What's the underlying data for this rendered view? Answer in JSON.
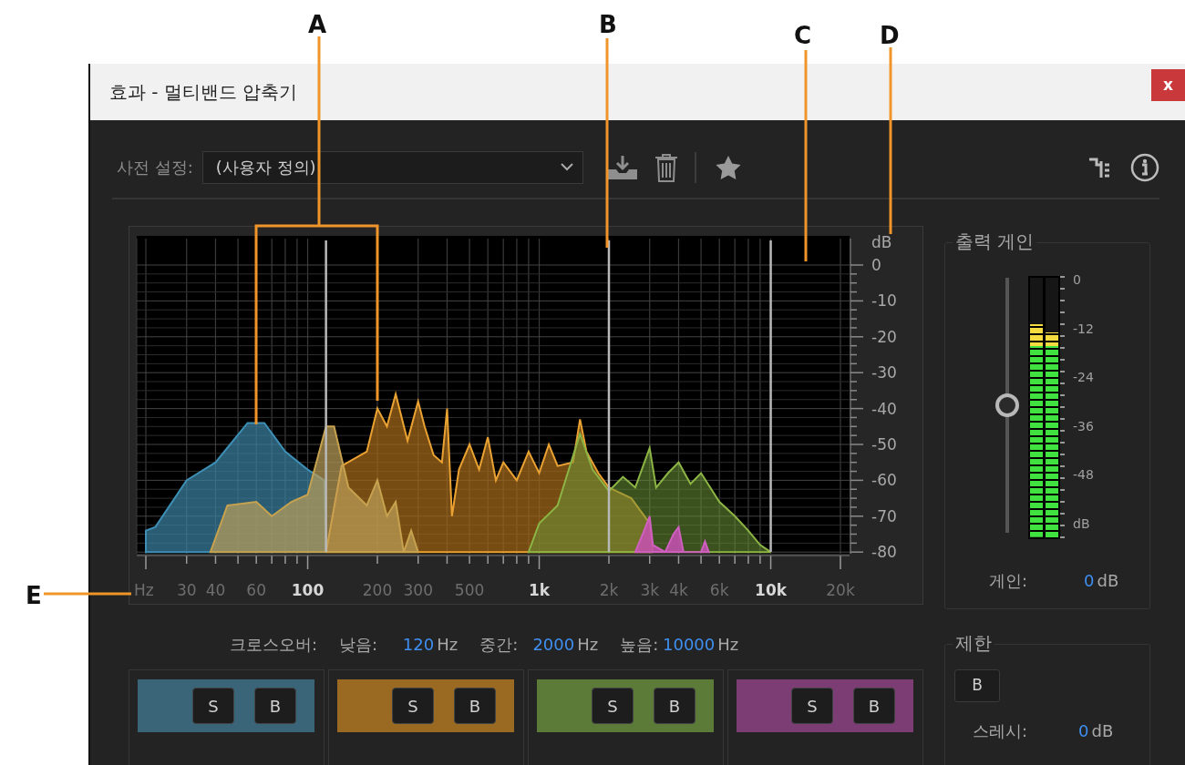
{
  "callouts": [
    {
      "label": "A"
    },
    {
      "label": "B"
    },
    {
      "label": "C"
    },
    {
      "label": "D"
    },
    {
      "label": "E"
    }
  ],
  "window": {
    "title": "효과 - 멀티밴드 압축기",
    "close": "x"
  },
  "toolbar": {
    "preset_label": "사전 설정:",
    "preset_value": "(사용자 정의)"
  },
  "graph": {
    "y_unit": "dB",
    "y_labels": [
      "0",
      "-10",
      "-20",
      "-30",
      "-40",
      "-50",
      "-60",
      "-70",
      "-80"
    ],
    "x_labels": [
      {
        "text": "Hz",
        "major": false
      },
      {
        "text": "30",
        "major": false
      },
      {
        "text": "40",
        "major": false
      },
      {
        "text": "60",
        "major": false
      },
      {
        "text": "100",
        "major": true
      },
      {
        "text": "200",
        "major": false
      },
      {
        "text": "300",
        "major": false
      },
      {
        "text": "500",
        "major": false
      },
      {
        "text": "1k",
        "major": true
      },
      {
        "text": "2k",
        "major": false
      },
      {
        "text": "3k",
        "major": false
      },
      {
        "text": "4k",
        "major": false
      },
      {
        "text": "6k",
        "major": false
      },
      {
        "text": "10k",
        "major": true
      },
      {
        "text": "20k",
        "major": false
      }
    ]
  },
  "crossover": {
    "label": "크로스오버:",
    "points": [
      {
        "label": "낮음:",
        "value": "120",
        "unit": "Hz"
      },
      {
        "label": "중간:",
        "value": "2000",
        "unit": "Hz"
      },
      {
        "label": "높음:",
        "value": "10000",
        "unit": "Hz"
      }
    ]
  },
  "bands": [
    {
      "color": "#3a6478",
      "solo": "S",
      "bypass": "B"
    },
    {
      "color": "#9a6a22",
      "solo": "S",
      "bypass": "B"
    },
    {
      "color": "#5c7a38",
      "solo": "S",
      "bypass": "B"
    },
    {
      "color": "#7c3c74",
      "solo": "S",
      "bypass": "B"
    }
  ],
  "output_gain": {
    "title": "출력 게인",
    "slider": {
      "level": 0.5
    },
    "meter": {
      "channels": [
        {
          "level": 0.82
        },
        {
          "level": 0.79
        }
      ],
      "labels": [
        "0",
        "-12",
        "-24",
        "-36",
        "-48",
        "dB"
      ]
    },
    "gain_label": "게인:",
    "gain_value": "0",
    "gain_unit": "dB"
  },
  "limit": {
    "title": "제한",
    "bypass": "B",
    "threshold_label": "스레시:",
    "threshold_value": "0",
    "threshold_unit": "dB"
  }
}
